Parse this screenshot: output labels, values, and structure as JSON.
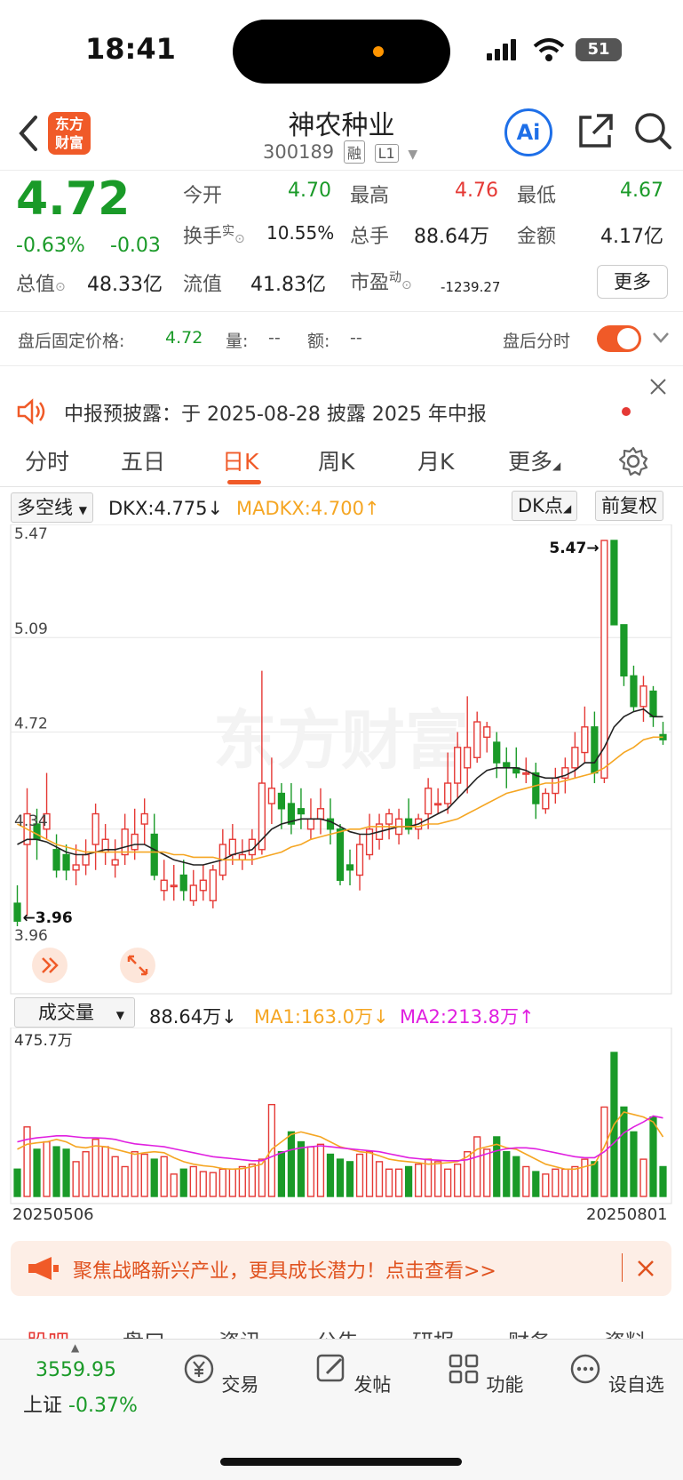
{
  "status_bar": {
    "time": "18:41",
    "battery": "51"
  },
  "header": {
    "logo_text": [
      "东方",
      "财富"
    ],
    "stock_name": "神农种业",
    "stock_code": "300189",
    "tag_margin": "融",
    "tag_level": "L1",
    "ai_label": "Ai"
  },
  "quote": {
    "price": "4.72",
    "change_pct": "-0.63%",
    "change": "-0.03",
    "open_label": "今开",
    "open": "4.70",
    "high_label": "最高",
    "high": "4.76",
    "low_label": "最低",
    "low": "4.67",
    "turnover_label": "换手",
    "turnover_sup": "实",
    "turnover": "10.55%",
    "volume_label": "总手",
    "volume": "88.64万",
    "amount_label": "金额",
    "amount": "4.17亿",
    "mktcap_label": "总值",
    "mktcap": "48.33亿",
    "float_label": "流值",
    "float": "41.83亿",
    "pe_label": "市盈",
    "pe_sup": "动",
    "pe": "-1239.27",
    "more_button": "更多"
  },
  "after_hours": {
    "price_label": "盘后固定价格:",
    "price": "4.72",
    "vol_label": "量:",
    "vol": "--",
    "amt_label": "额:",
    "amt": "--",
    "timeshare_label": "盘后分时"
  },
  "notice": {
    "text": "中报预披露：于 2025-08-28 披露 2025 年中报"
  },
  "tabs": [
    "分时",
    "五日",
    "日K",
    "周K",
    "月K",
    "更多"
  ],
  "indicator": {
    "select": "多空线",
    "dkx": "DKX:4.775",
    "madkx": "MADKX:4.700",
    "dk_button": "DK点",
    "adjust_button": "前复权"
  },
  "volume_bar": {
    "select": "成交量",
    "vol": "88.64万",
    "ma1": "MA1:163.0万",
    "ma2": "MA2:213.8万",
    "max_label": "475.7万"
  },
  "dates": {
    "start": "20250506",
    "end": "20250801"
  },
  "banner": {
    "text": "聚焦战略新兴产业，更具成长潜力！点击查看>>"
  },
  "subtabs": [
    "股吧",
    "盘口",
    "资讯",
    "公告",
    "研报",
    "财务",
    "资料"
  ],
  "bottom_nav": {
    "index_value": "3559.95",
    "index_name": "上证",
    "index_change": "-0.37%",
    "trade": "交易",
    "post": "发帖",
    "functions": "功能",
    "watchlist": "设自选"
  },
  "colors": {
    "up": "#e53935",
    "down": "#1a9a28",
    "accent": "#f05a28",
    "ma_orange": "#f5a623",
    "ma_magenta": "#e020e0"
  },
  "chart_data": {
    "type": "candlestick",
    "price_axis_labels": [
      "5.47",
      "5.09",
      "4.72",
      "4.34",
      "3.96"
    ],
    "ylim": [
      3.96,
      5.47
    ],
    "annotation_high": "5.47→",
    "annotation_low": "←3.96",
    "candles": [
      [
        4.05,
        3.98,
        4.12,
        3.96
      ],
      [
        4.28,
        4.4,
        4.5,
        4.0
      ],
      [
        4.36,
        4.3,
        4.42,
        4.22
      ],
      [
        4.34,
        4.4,
        4.56,
        4.3
      ],
      [
        4.26,
        4.18,
        4.32,
        4.15
      ],
      [
        4.24,
        4.18,
        4.28,
        4.14
      ],
      [
        4.18,
        4.2,
        4.28,
        4.12
      ],
      [
        4.2,
        4.24,
        4.3,
        4.16
      ],
      [
        4.28,
        4.4,
        4.44,
        4.18
      ],
      [
        4.25,
        4.3,
        4.36,
        4.2
      ],
      [
        4.2,
        4.22,
        4.3,
        4.15
      ],
      [
        4.24,
        4.34,
        4.4,
        4.2
      ],
      [
        4.26,
        4.32,
        4.42,
        4.22
      ],
      [
        4.36,
        4.4,
        4.46,
        4.28
      ],
      [
        4.32,
        4.16,
        4.4,
        4.14
      ],
      [
        4.1,
        4.14,
        4.22,
        4.06
      ],
      [
        4.12,
        4.12,
        4.2,
        4.06
      ],
      [
        4.16,
        4.1,
        4.22,
        4.06
      ],
      [
        4.06,
        4.12,
        4.18,
        4.04
      ],
      [
        4.1,
        4.14,
        4.2,
        4.06
      ],
      [
        4.06,
        4.18,
        4.2,
        4.03
      ],
      [
        4.16,
        4.28,
        4.34,
        4.14
      ],
      [
        4.24,
        4.3,
        4.36,
        4.2
      ],
      [
        4.22,
        4.24,
        4.3,
        4.18
      ],
      [
        4.24,
        4.3,
        4.34,
        4.2
      ],
      [
        4.26,
        4.52,
        4.96,
        4.24
      ],
      [
        4.44,
        4.5,
        4.62,
        4.36
      ],
      [
        4.48,
        4.42,
        4.52,
        4.34
      ],
      [
        4.44,
        4.36,
        4.52,
        4.32
      ],
      [
        4.42,
        4.4,
        4.5,
        4.34
      ],
      [
        4.34,
        4.38,
        4.46,
        4.3
      ],
      [
        4.38,
        4.42,
        4.5,
        4.32
      ],
      [
        4.38,
        4.34,
        4.46,
        4.28
      ],
      [
        4.34,
        4.14,
        4.36,
        4.12
      ],
      [
        4.2,
        4.18,
        4.26,
        4.12
      ],
      [
        4.16,
        4.28,
        4.32,
        4.1
      ],
      [
        4.24,
        4.34,
        4.4,
        4.22
      ],
      [
        4.3,
        4.36,
        4.4,
        4.26
      ],
      [
        4.36,
        4.4,
        4.42,
        4.3
      ],
      [
        4.32,
        4.38,
        4.42,
        4.28
      ],
      [
        4.38,
        4.34,
        4.46,
        4.32
      ],
      [
        4.34,
        4.38,
        4.4,
        4.3
      ],
      [
        4.4,
        4.5,
        4.54,
        4.34
      ],
      [
        4.44,
        4.44,
        4.5,
        4.4
      ],
      [
        4.44,
        4.52,
        4.64,
        4.4
      ],
      [
        4.52,
        4.66,
        4.72,
        4.46
      ],
      [
        4.58,
        4.66,
        4.86,
        4.48
      ],
      [
        4.62,
        4.76,
        4.8,
        4.6
      ],
      [
        4.7,
        4.74,
        4.76,
        4.64
      ],
      [
        4.68,
        4.6,
        4.72,
        4.54
      ],
      [
        4.6,
        4.58,
        4.66,
        4.5
      ],
      [
        4.58,
        4.56,
        4.66,
        4.54
      ],
      [
        4.56,
        4.56,
        4.62,
        4.52
      ],
      [
        4.56,
        4.44,
        4.6,
        4.38
      ],
      [
        4.42,
        4.48,
        4.5,
        4.4
      ],
      [
        4.48,
        4.54,
        4.58,
        4.44
      ],
      [
        4.54,
        4.58,
        4.62,
        4.48
      ],
      [
        4.58,
        4.66,
        4.72,
        4.54
      ],
      [
        4.64,
        4.74,
        4.82,
        4.6
      ],
      [
        4.74,
        4.56,
        4.8,
        4.52
      ],
      [
        4.54,
        5.47,
        5.47,
        4.52
      ],
      [
        5.47,
        5.14,
        5.47,
        5.14
      ],
      [
        5.14,
        4.94,
        5.14,
        4.9
      ],
      [
        4.94,
        4.82,
        4.98,
        4.8
      ],
      [
        4.82,
        4.9,
        4.94,
        4.76
      ],
      [
        4.88,
        4.78,
        4.9,
        4.74
      ],
      [
        4.71,
        4.69,
        4.76,
        4.67
      ]
    ],
    "dkx": [
      4.28,
      4.3,
      4.3,
      4.29,
      4.27,
      4.25,
      4.24,
      4.24,
      4.25,
      4.26,
      4.26,
      4.27,
      4.28,
      4.28,
      4.26,
      4.24,
      4.22,
      4.21,
      4.2,
      4.2,
      4.21,
      4.22,
      4.24,
      4.25,
      4.26,
      4.3,
      4.34,
      4.36,
      4.37,
      4.38,
      4.38,
      4.38,
      4.37,
      4.35,
      4.33,
      4.32,
      4.32,
      4.33,
      4.34,
      4.35,
      4.35,
      4.36,
      4.38,
      4.4,
      4.42,
      4.46,
      4.5,
      4.54,
      4.57,
      4.58,
      4.58,
      4.58,
      4.57,
      4.55,
      4.54,
      4.54,
      4.55,
      4.57,
      4.6,
      4.6,
      4.66,
      4.74,
      4.78,
      4.8,
      4.81,
      4.78,
      4.78
    ],
    "madkx": [
      4.36,
      4.34,
      4.32,
      4.3,
      4.28,
      4.27,
      4.26,
      4.25,
      4.25,
      4.25,
      4.25,
      4.25,
      4.25,
      4.25,
      4.25,
      4.25,
      4.24,
      4.24,
      4.23,
      4.23,
      4.23,
      4.22,
      4.22,
      4.22,
      4.22,
      4.23,
      4.24,
      4.25,
      4.27,
      4.28,
      4.3,
      4.31,
      4.32,
      4.33,
      4.34,
      4.34,
      4.35,
      4.35,
      4.35,
      4.35,
      4.35,
      4.35,
      4.36,
      4.36,
      4.37,
      4.38,
      4.4,
      4.42,
      4.44,
      4.46,
      4.48,
      4.49,
      4.5,
      4.51,
      4.52,
      4.52,
      4.53,
      4.54,
      4.55,
      4.56,
      4.58,
      4.61,
      4.64,
      4.66,
      4.69,
      4.7,
      4.7
    ],
    "volumes": [
      55,
      140,
      95,
      110,
      100,
      95,
      70,
      90,
      115,
      100,
      80,
      60,
      90,
      85,
      75,
      80,
      45,
      55,
      60,
      50,
      48,
      55,
      55,
      60,
      65,
      75,
      185,
      90,
      130,
      110,
      100,
      105,
      85,
      75,
      70,
      85,
      90,
      70,
      55,
      55,
      60,
      65,
      75,
      70,
      55,
      65,
      90,
      120,
      95,
      120,
      90,
      80,
      60,
      50,
      45,
      55,
      55,
      60,
      75,
      70,
      180,
      290,
      180,
      130,
      75,
      160,
      60
    ],
    "ma1": [
      95,
      105,
      108,
      110,
      115,
      110,
      100,
      98,
      102,
      100,
      95,
      90,
      85,
      88,
      90,
      88,
      78,
      70,
      65,
      62,
      60,
      56,
      55,
      56,
      60,
      65,
      95,
      110,
      125,
      130,
      125,
      120,
      110,
      100,
      95,
      90,
      88,
      82,
      75,
      72,
      70,
      68,
      65,
      66,
      68,
      70,
      80,
      95,
      100,
      105,
      98,
      95,
      85,
      75,
      65,
      60,
      55,
      55,
      60,
      65,
      100,
      145,
      170,
      165,
      160,
      150,
      120
    ],
    "ma2": [
      110,
      115,
      118,
      120,
      122,
      122,
      120,
      118,
      118,
      117,
      115,
      110,
      106,
      104,
      102,
      100,
      96,
      92,
      88,
      84,
      80,
      78,
      76,
      74,
      72,
      72,
      80,
      88,
      94,
      98,
      100,
      102,
      100,
      98,
      96,
      94,
      92,
      90,
      86,
      82,
      78,
      76,
      74,
      73,
      72,
      72,
      74,
      80,
      86,
      92,
      96,
      98,
      98,
      96,
      92,
      88,
      84,
      80,
      78,
      78,
      90,
      108,
      128,
      140,
      150,
      162,
      158
    ]
  }
}
